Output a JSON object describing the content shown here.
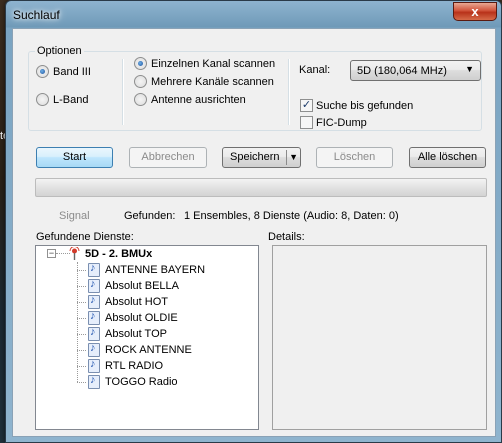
{
  "window": {
    "title": "Suchlauf",
    "close_glyph": "x"
  },
  "options": {
    "group_label": "Optionen",
    "band_radios": [
      {
        "label": "Band III",
        "checked": true
      },
      {
        "label": "L-Band",
        "checked": false
      }
    ],
    "mode_radios": [
      {
        "label": "Einzelnen Kanal scannen",
        "checked": true
      },
      {
        "label": "Mehrere Kanäle scannen",
        "checked": false
      },
      {
        "label": "Antenne ausrichten",
        "checked": false
      }
    ],
    "channel_label": "Kanal:",
    "channel_value": "5D (180,064 MHz)",
    "checkboxes": [
      {
        "label": "Suche bis gefunden",
        "checked": true
      },
      {
        "label": "FIC-Dump",
        "checked": false
      }
    ]
  },
  "buttons": {
    "start": "Start",
    "abort": "Abbrechen",
    "save": "Speichern",
    "delete": "Löschen",
    "delete_all": "Alle löschen"
  },
  "progress": {
    "value": 0
  },
  "status": {
    "signal_label": "Signal",
    "found_label": "Gefunden:",
    "found_text": "1 Ensembles, 8 Dienste (Audio: 8, Daten: 0)"
  },
  "services": {
    "label": "Gefundene Dienste:",
    "ensemble": "5D - 2. BMUx",
    "items": [
      "ANTENNE BAYERN",
      "Absolut BELLA",
      "Absolut HOT",
      "Absolut OLDIE",
      "Absolut TOP",
      "ROCK ANTENNE",
      "RTL RADIO",
      "TOGGO Radio"
    ]
  },
  "details": {
    "label": "Details:"
  },
  "background": {
    "sliver_text": "te"
  },
  "colors": {
    "title_bar": "#7aa4c2",
    "close_button": "#c9432a",
    "client_bg": "#f0f0f0"
  }
}
